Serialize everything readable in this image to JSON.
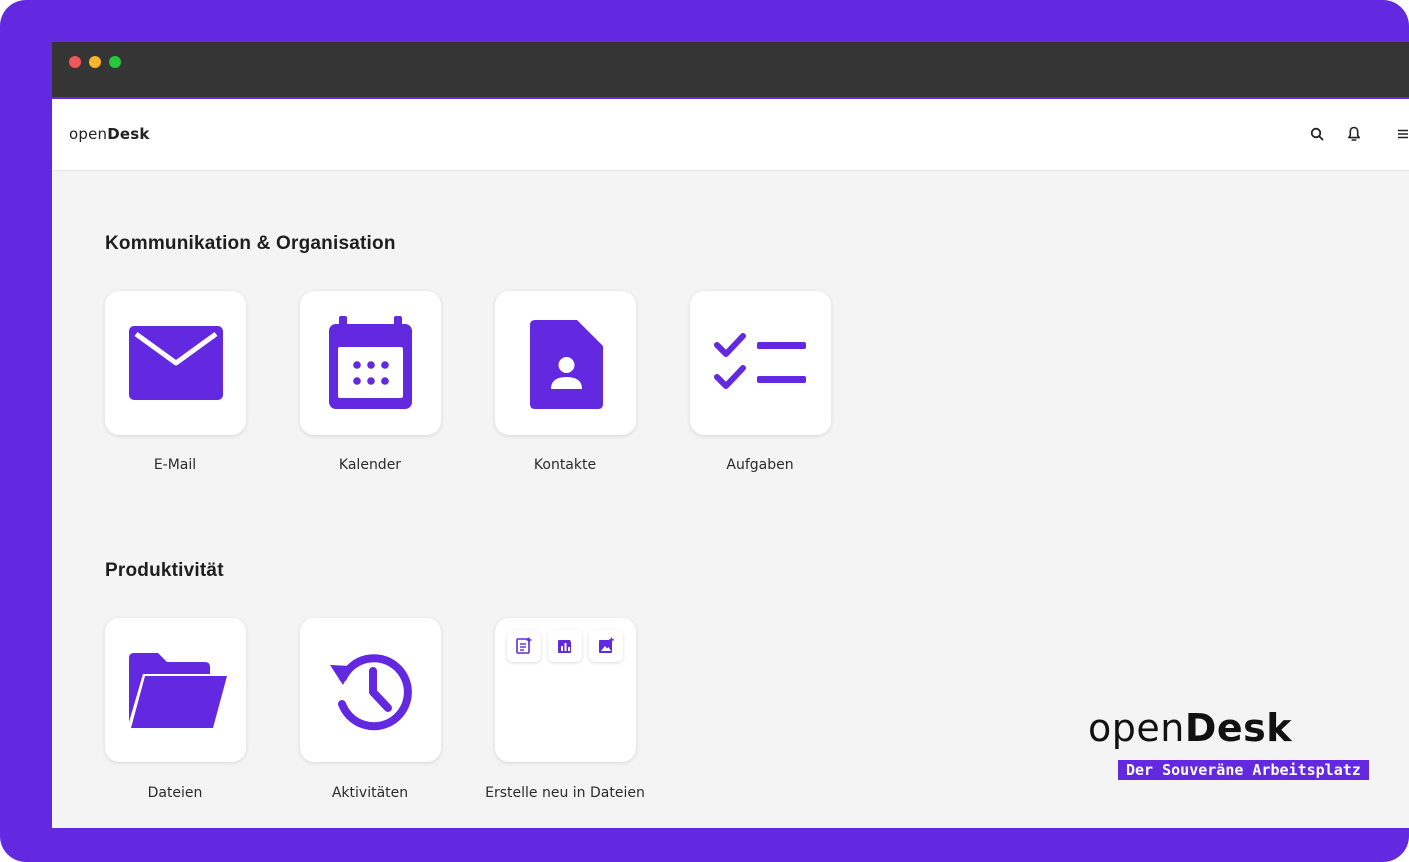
{
  "app": {
    "brand_prefix": "open",
    "brand_suffix": "Desk"
  },
  "header": {
    "icons": [
      "search-icon",
      "bell-icon",
      "menu-icon"
    ]
  },
  "sections": [
    {
      "title": "Kommunikation & Organisation",
      "apps": [
        {
          "label": "E-Mail",
          "icon": "mail-icon"
        },
        {
          "label": "Kalender",
          "icon": "calendar-icon"
        },
        {
          "label": "Kontakte",
          "icon": "contact-icon"
        },
        {
          "label": "Aufgaben",
          "icon": "tasks-icon"
        }
      ]
    },
    {
      "title": "Produktivität",
      "apps": [
        {
          "label": "Dateien",
          "icon": "folder-icon"
        },
        {
          "label": "Aktivitäten",
          "icon": "history-icon"
        },
        {
          "label": "Erstelle neu in Dateien",
          "icon": "create-new-icon",
          "actions": [
            "new-document-icon",
            "new-spreadsheet-icon",
            "new-presentation-icon"
          ]
        }
      ]
    }
  ],
  "promo": {
    "brand_prefix": "open",
    "brand_suffix": "Desk",
    "tagline": "Der Souveräne Arbeitsplatz"
  },
  "colors": {
    "accent": "#6329e0",
    "frame": "#6329e0",
    "titlebar": "#353535",
    "background": "#f4f4f4"
  }
}
